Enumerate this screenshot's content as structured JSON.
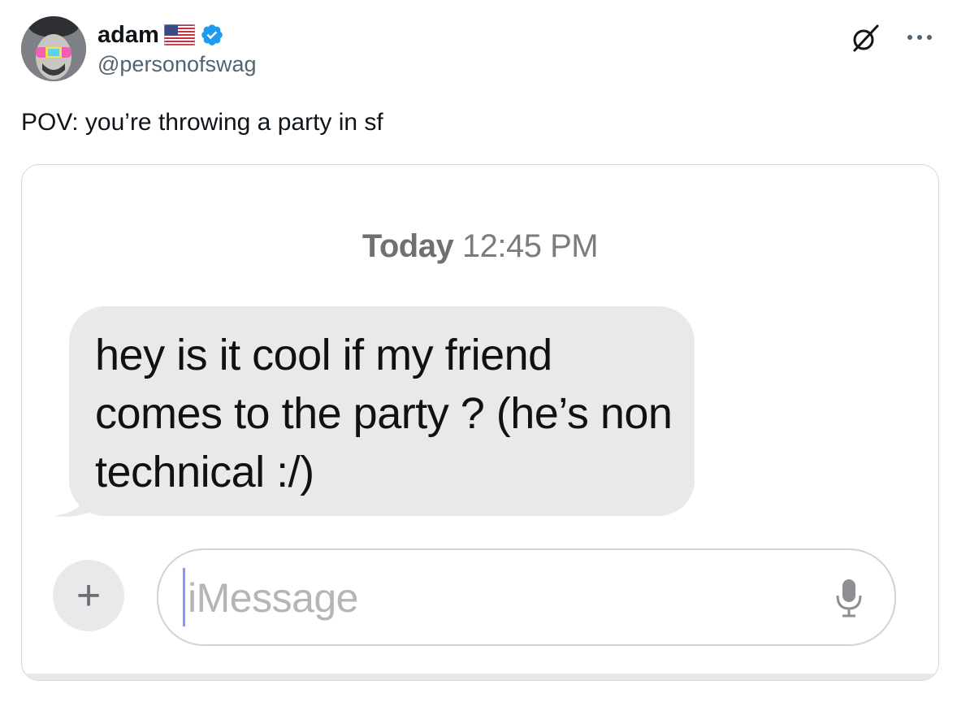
{
  "author": {
    "display_name": "adam",
    "handle": "@personofswag",
    "flag": "us-flag-icon",
    "verified": true
  },
  "header_icons": {
    "grok": "grok-icon",
    "more": "more-icon"
  },
  "tweet": {
    "text": "POV: you’re throwing a party in sf"
  },
  "screenshot": {
    "timestamp_day": "Today",
    "timestamp_time": "12:45 PM",
    "message": "hey is it cool if my friend comes to the party ? (he’s non technical :/)",
    "input_placeholder": "iMessage",
    "plus_label": "+"
  },
  "colors": {
    "verified_blue": "#1d9bf0",
    "bubble_gray": "#e9e9eb",
    "handle_gray": "#536471"
  }
}
